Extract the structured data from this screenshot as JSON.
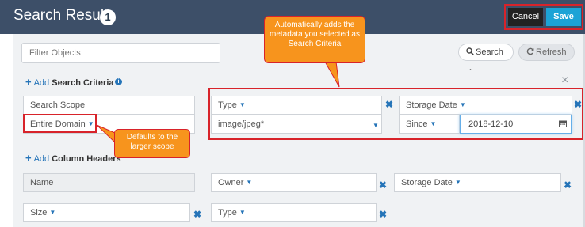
{
  "header": {
    "title": "Search Results",
    "result_count": "1",
    "cancel_label": "Cancel",
    "save_label": "Save"
  },
  "toolbar": {
    "filter_placeholder": "Filter Objects",
    "search_label": "Search",
    "refresh_label": "Refresh"
  },
  "criteria": {
    "add_word": "Add",
    "add_label": "Search Criteria",
    "scope_header": "Search Scope",
    "scope_value": "Entire Domain",
    "type_header": "Type",
    "type_value": "image/jpeg*",
    "storage_header": "Storage Date",
    "storage_operator": "Since",
    "storage_value": "2018-12-10"
  },
  "columns": {
    "add_word": "Add",
    "add_label": "Column Headers",
    "items": [
      "Name",
      "Owner",
      "Storage Date",
      "Size",
      "Type"
    ]
  },
  "annotations": {
    "criteria_note": "Automatically adds the metadata you selected as Search Criteria",
    "scope_note": "Defaults to the larger scope"
  },
  "colors": {
    "header_bg": "#3d4f68",
    "accent": "#1ca3d6",
    "link": "#2574b8",
    "highlight": "#d8232a",
    "callout": "#f7941d"
  }
}
